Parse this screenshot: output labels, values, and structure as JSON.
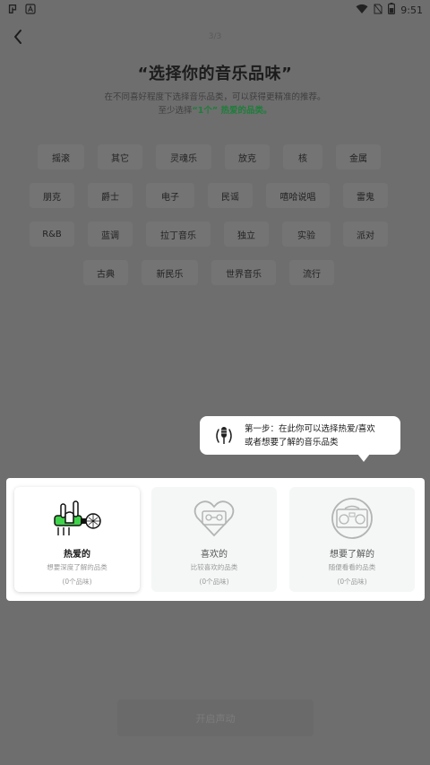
{
  "status_bar": {
    "left_icons": [
      "bug-app-icon",
      "app-a-icon"
    ],
    "time": "9:51",
    "right_icons": [
      "wifi-icon",
      "no-sim-icon",
      "battery-icon"
    ]
  },
  "header": {
    "progress": "3/3",
    "title": "“选择你的音乐品味”",
    "subtitle_line1": "在不同喜好程度下选择音乐品类，可以获得更精准的推荐。",
    "subtitle_line2_prefix": "至少选择",
    "subtitle_line2_highlight": "“1个” 热爱的品类。"
  },
  "genres": [
    "摇滚",
    "其它",
    "灵魂乐",
    "放克",
    "核",
    "金属",
    "朋克",
    "爵士",
    "电子",
    "民谣",
    "嘻哈说唱",
    "雷鬼",
    "R&B",
    "蓝调",
    "拉丁音乐",
    "独立",
    "实验",
    "派对",
    "古典",
    "新民乐",
    "世界音乐",
    "流行"
  ],
  "tooltip": {
    "line1": "第一步：在此你可以选择热爱/喜欢",
    "line2": "或者想要了解的音乐品类"
  },
  "categories": [
    {
      "title": "热爱的",
      "desc": "想要深度了解的品类",
      "count": "(0个品味)",
      "icon": "rock-hand-microphone-icon"
    },
    {
      "title": "喜欢的",
      "desc": "比较喜欢的品类",
      "count": "(0个品味)",
      "icon": "heart-cassette-icon"
    },
    {
      "title": "想要了解的",
      "desc": "随便看看的品类",
      "count": "(0个品味)",
      "icon": "boombox-icon"
    }
  ],
  "start_button": "开启声动",
  "colors": {
    "accent": "#1f7d3b",
    "highlight_green": "#3fd24a",
    "overlay": "#6e6e6e"
  }
}
